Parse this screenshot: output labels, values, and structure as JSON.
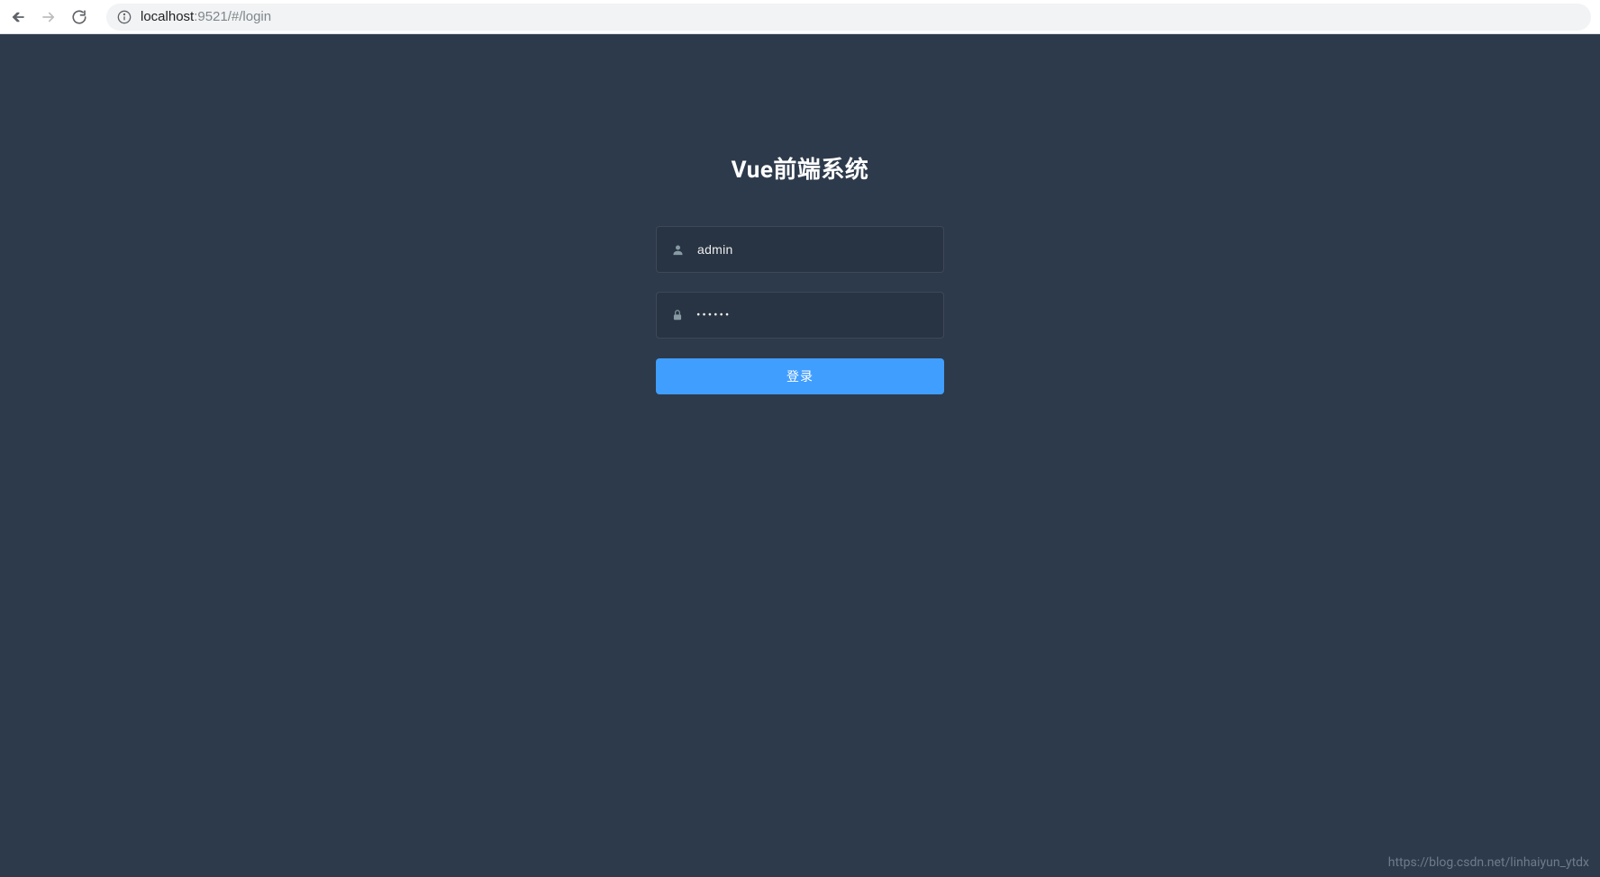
{
  "browser": {
    "url_host": "localhost",
    "url_port_path": ":9521/#/login"
  },
  "login": {
    "title": "Vue前端系统",
    "username_value": "admin",
    "password_value": "••••••",
    "submit_label": "登录"
  },
  "watermark": "https://blog.csdn.net/linhaiyun_ytdx"
}
